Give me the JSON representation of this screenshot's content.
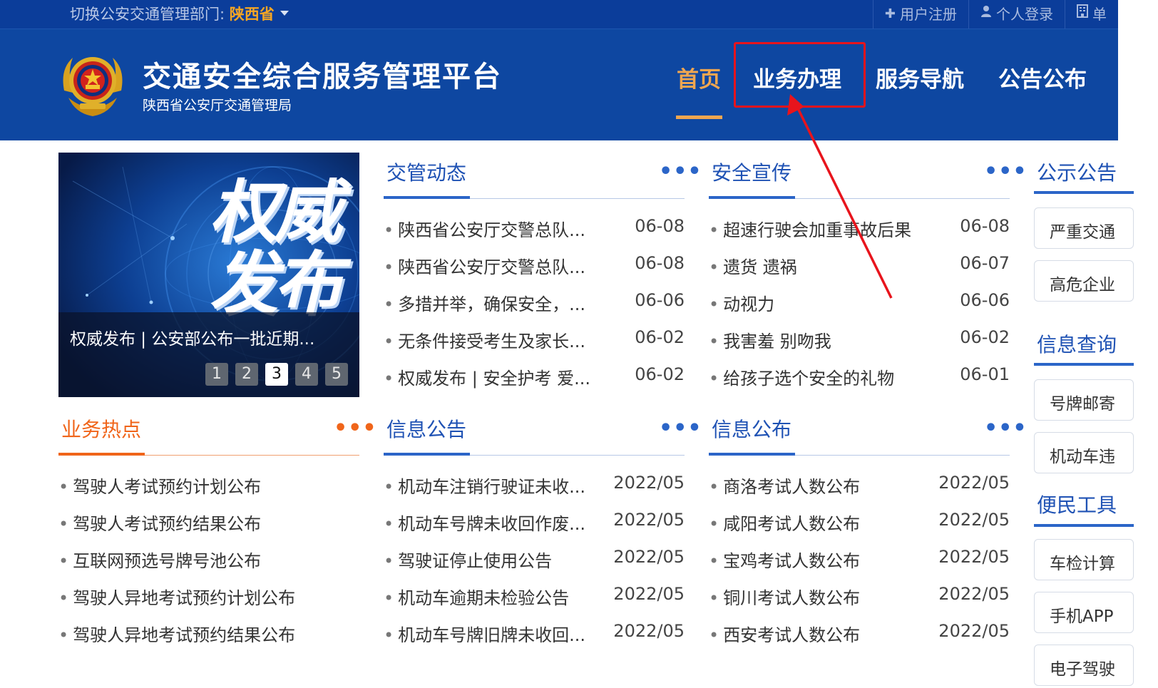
{
  "topbar": {
    "switch_prefix": "切换公安交通管理部门: ",
    "province": "陕西省",
    "links": [
      {
        "icon": "plus-icon",
        "label": "用户注册"
      },
      {
        "icon": "user-icon",
        "label": "个人登录"
      },
      {
        "icon": "building-icon",
        "label": "单"
      }
    ]
  },
  "header": {
    "title": "交通安全综合服务管理平台",
    "subtitle": "陕西省公安厅交通管理局",
    "nav": [
      "首页",
      "业务办理",
      "服务导航",
      "公告公布"
    ],
    "active_nav": "首页",
    "highlighted_nav": "业务办理"
  },
  "banner": {
    "image_text_line1": "权威",
    "image_text_line2": "发布",
    "caption": "权威发布 | 公安部公布一批近期...",
    "pages": [
      "1",
      "2",
      "3",
      "4",
      "5"
    ],
    "active_page": "3"
  },
  "panels": {
    "jiaoguan": {
      "title": "交管动态",
      "more": "•••",
      "items": [
        {
          "title": "陕西省公安厅交警总队...",
          "date": "06-08"
        },
        {
          "title": "陕西省公安厅交警总队...",
          "date": "06-08"
        },
        {
          "title": "多措并举，确保安全，...",
          "date": "06-06"
        },
        {
          "title": "无条件接受考生及家长...",
          "date": "06-02"
        },
        {
          "title": "权威发布 | 安全护考 爱...",
          "date": "06-02"
        }
      ]
    },
    "anquan": {
      "title": "安全宣传",
      "more": "•••",
      "items": [
        {
          "title": "超速行驶会加重事故后果",
          "date": "06-08"
        },
        {
          "title": "遗货 遗祸",
          "date": "06-07"
        },
        {
          "title": "动视力",
          "date": "06-06"
        },
        {
          "title": "我害羞 别吻我",
          "date": "06-02"
        },
        {
          "title": "给孩子选个安全的礼物",
          "date": "06-01"
        }
      ]
    },
    "redian": {
      "title": "业务热点",
      "more": "•••",
      "items": [
        {
          "title": "驾驶人考试预约计划公布"
        },
        {
          "title": "驾驶人考试预约结果公布"
        },
        {
          "title": "互联网预选号牌号池公布"
        },
        {
          "title": "驾驶人异地考试预约计划公布"
        },
        {
          "title": "驾驶人异地考试预约结果公布"
        }
      ]
    },
    "xinxi_gonggao": {
      "title": "信息公告",
      "more": "•••",
      "items": [
        {
          "title": "机动车注销行驶证未收...",
          "date": "2022/05"
        },
        {
          "title": "机动车号牌未收回作废...",
          "date": "2022/05"
        },
        {
          "title": "驾驶证停止使用公告",
          "date": "2022/05"
        },
        {
          "title": "机动车逾期未检验公告",
          "date": "2022/05"
        },
        {
          "title": "机动车号牌旧牌未收回...",
          "date": "2022/05"
        }
      ]
    },
    "xinxi_gongbu": {
      "title": "信息公布",
      "more": "•••",
      "items": [
        {
          "title": "商洛考试人数公布",
          "date": "2022/05"
        },
        {
          "title": "咸阳考试人数公布",
          "date": "2022/05"
        },
        {
          "title": "宝鸡考试人数公布",
          "date": "2022/05"
        },
        {
          "title": "铜川考试人数公布",
          "date": "2022/05"
        },
        {
          "title": "西安考试人数公布",
          "date": "2022/05"
        }
      ]
    }
  },
  "side": {
    "sections": [
      {
        "title": "公示公告",
        "cards": [
          "严重交通",
          "高危企业"
        ]
      },
      {
        "title": "信息查询",
        "cards": [
          "号牌邮寄",
          "机动车违"
        ]
      },
      {
        "title": "便民工具",
        "cards": [
          "车检计算",
          "手机APP",
          "电子驾驶"
        ]
      }
    ]
  },
  "colors": {
    "topbar_bg": "#0b3d9a",
    "header_bg": "#0e47a1",
    "accent_orange": "#f0a650",
    "link_blue": "#1f52b4",
    "hot_orange": "#f0651a",
    "annotation_red": "#e8141c"
  }
}
